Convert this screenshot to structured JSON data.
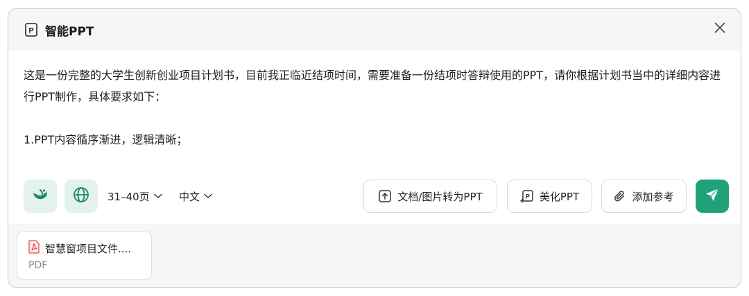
{
  "dialog": {
    "title": "智能PPT",
    "icons": {
      "logo": "ppt-logo-icon",
      "close": "close-icon"
    }
  },
  "prompt": {
    "text": "这是一份完整的大学生创新创业项目计划书，目前我正临近结项时间，需要准备一份结项时答辩使用的PPT，请你根据计划书当中的详细内容进行PPT制作，具体要求如下：\n\n1.PPT内容循序渐进，逻辑清晰；"
  },
  "toolbar": {
    "model_icon": "bird-logo-icon",
    "web_icon": "globe-icon",
    "page_range": "31–40页",
    "language": "中文",
    "convert_label": "文档/图片转为PPT",
    "beautify_label": "美化PPT",
    "add_reference_label": "添加参考",
    "send_icon": "paper-plane-icon",
    "accent_color": "#1fa27a"
  },
  "attachment": {
    "file_name": "智慧窗项目文件....",
    "file_type": "PDF",
    "icon": "pdf-file-icon"
  }
}
